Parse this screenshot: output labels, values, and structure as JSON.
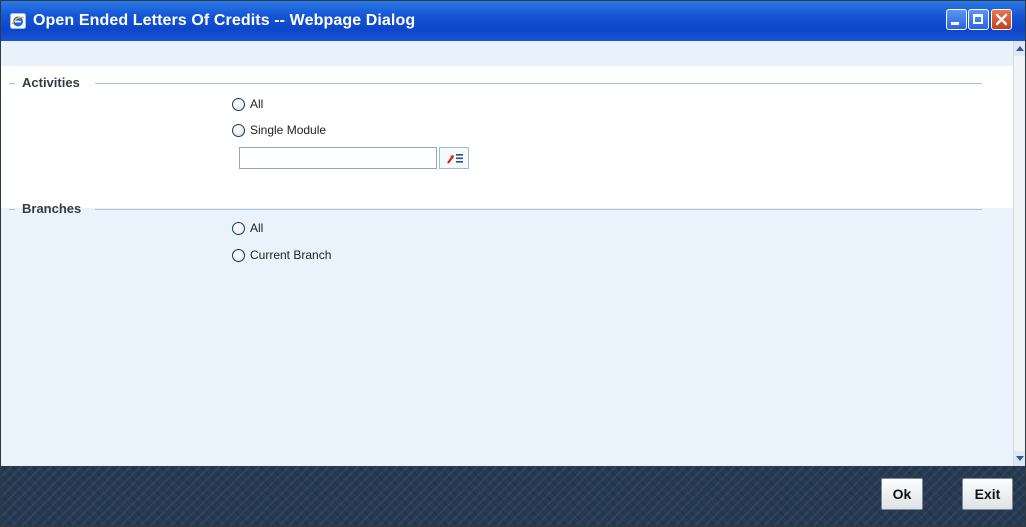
{
  "window": {
    "title": "Open Ended Letters Of Credits -- Webpage Dialog",
    "icon": "ie-icon"
  },
  "activities": {
    "legend": "Activities",
    "options": [
      {
        "label": "All",
        "selected": false
      },
      {
        "label": "Single Module",
        "selected": false
      }
    ],
    "module_input": {
      "value": "",
      "placeholder": ""
    }
  },
  "branches": {
    "legend": "Branches",
    "options": [
      {
        "label": "All",
        "selected": false
      },
      {
        "label": "Current Branch",
        "selected": false
      }
    ]
  },
  "footer": {
    "ok_label": "Ok",
    "exit_label": "Exit"
  },
  "colors": {
    "titlebar": "#1656d6",
    "content_band": "#eaf3fb",
    "footer": "#263a52"
  }
}
